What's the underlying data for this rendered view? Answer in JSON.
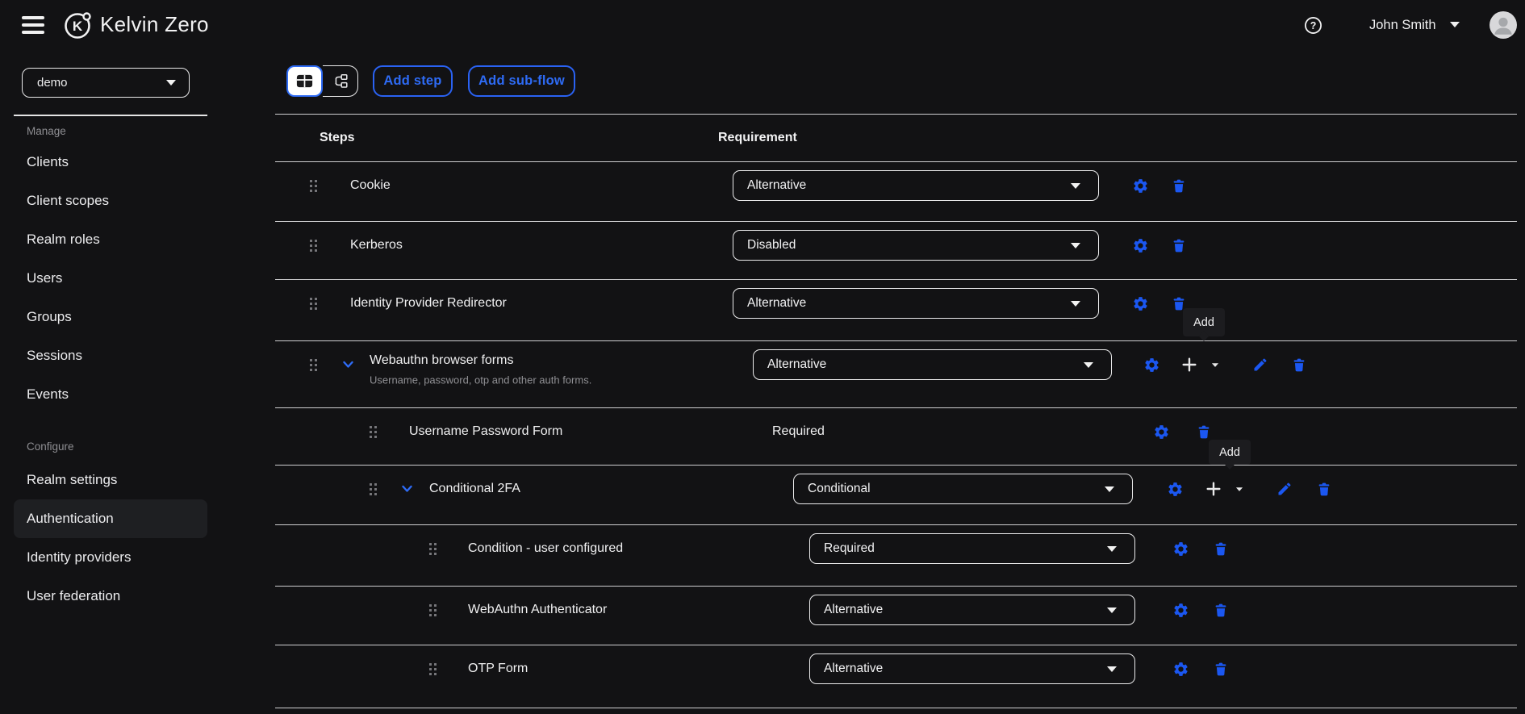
{
  "topbar": {
    "brand": "Kelvin Zero",
    "user_name": "John Smith"
  },
  "sidebar": {
    "realm_selector_value": "demo",
    "selected_item": "Authentication",
    "sections": [
      {
        "label": "Manage",
        "items": [
          "Clients",
          "Client scopes",
          "Realm roles",
          "Users",
          "Groups",
          "Sessions",
          "Events"
        ]
      },
      {
        "label": "Configure",
        "items": [
          "Realm settings",
          "Authentication",
          "Identity providers",
          "User federation"
        ]
      }
    ]
  },
  "toolbar": {
    "add_step_label": "Add step",
    "add_subflow_label": "Add sub-flow",
    "view_modes": [
      "table",
      "diagram"
    ],
    "selected_view": "table"
  },
  "table": {
    "columns": [
      "Steps",
      "Requirement"
    ],
    "requirement_colors": {
      "accent": "#1b57f1"
    },
    "rows": [
      {
        "name": "Cookie",
        "requirement": "Alternative",
        "control": "select",
        "depth": 0,
        "actions": [
          "settings",
          "delete"
        ]
      },
      {
        "name": "Kerberos",
        "requirement": "Disabled",
        "control": "select",
        "depth": 0,
        "actions": [
          "settings",
          "delete"
        ]
      },
      {
        "name": "Identity Provider Redirector",
        "requirement": "Alternative",
        "control": "select",
        "depth": 0,
        "actions": [
          "settings",
          "delete"
        ],
        "tooltip": "Add"
      },
      {
        "name": "Webauthn browser forms",
        "description": "Username, password, otp and other auth forms.",
        "requirement": "Alternative",
        "control": "select",
        "depth": 0,
        "expanded": true,
        "actions": [
          "settings",
          "add",
          "add-options",
          "edit",
          "delete"
        ]
      },
      {
        "name": "Username Password Form",
        "requirement": "Required",
        "control": "text",
        "depth": 1,
        "actions": [
          "settings",
          "delete"
        ],
        "tooltip": "Add"
      },
      {
        "name": "Conditional 2FA",
        "requirement": "Conditional",
        "control": "select",
        "depth": 1,
        "expanded": true,
        "actions": [
          "settings",
          "add",
          "add-options",
          "edit",
          "delete"
        ]
      },
      {
        "name": "Condition - user configured",
        "requirement": "Required",
        "control": "select",
        "depth": 2,
        "actions": [
          "settings",
          "delete"
        ]
      },
      {
        "name": "WebAuthn Authenticator",
        "requirement": "Alternative",
        "control": "select",
        "depth": 2,
        "actions": [
          "settings",
          "delete"
        ]
      },
      {
        "name": "OTP Form",
        "requirement": "Alternative",
        "control": "select",
        "depth": 2,
        "actions": [
          "settings",
          "delete"
        ]
      }
    ]
  },
  "colors": {
    "background": "#121214",
    "accent_blue": "#1b57f1",
    "button_blue": "#2e6bf5",
    "divider": "#cfcfd1",
    "muted_text": "#8e8e92"
  }
}
